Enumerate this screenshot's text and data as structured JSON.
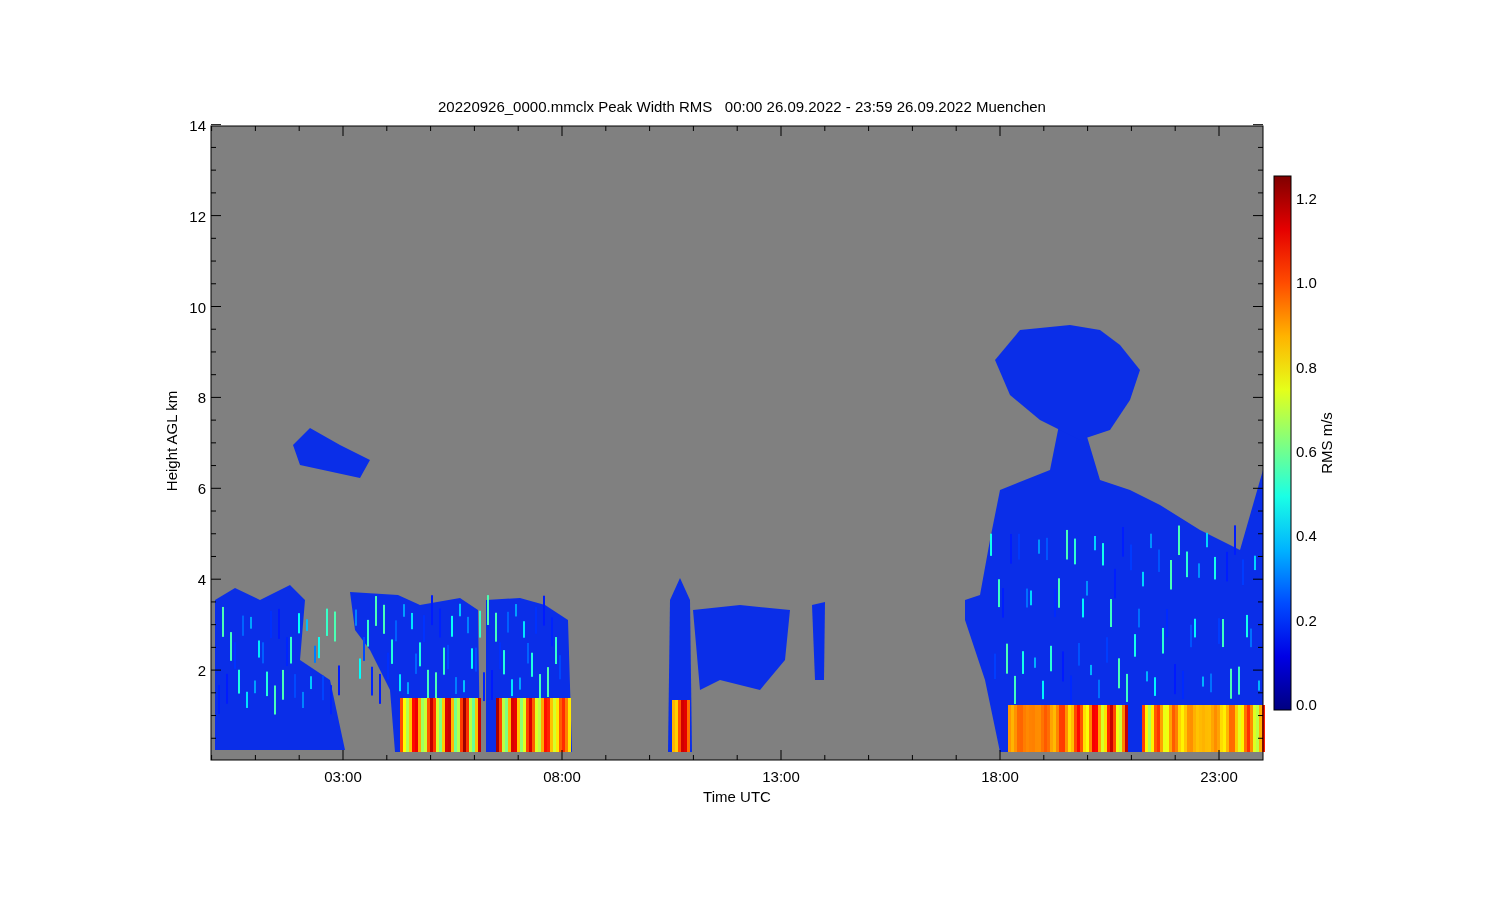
{
  "title": "20220926_0000.mmclx Peak Width RMS   00:00 26.09.2022 - 23:59 26.09.2022 Muenchen",
  "y_axis": {
    "label": "Height AGL km",
    "ticks": [
      "14",
      "12",
      "10",
      "8",
      "6",
      "4",
      "2"
    ]
  },
  "x_axis": {
    "label": "Time UTC",
    "ticks": [
      "03:00",
      "08:00",
      "13:00",
      "18:00",
      "23:00"
    ]
  },
  "colorbar": {
    "label": "RMS m/s",
    "ticks": [
      "1.2",
      "1.0",
      "0.8",
      "0.6",
      "0.4",
      "0.2",
      "0.0"
    ]
  }
}
